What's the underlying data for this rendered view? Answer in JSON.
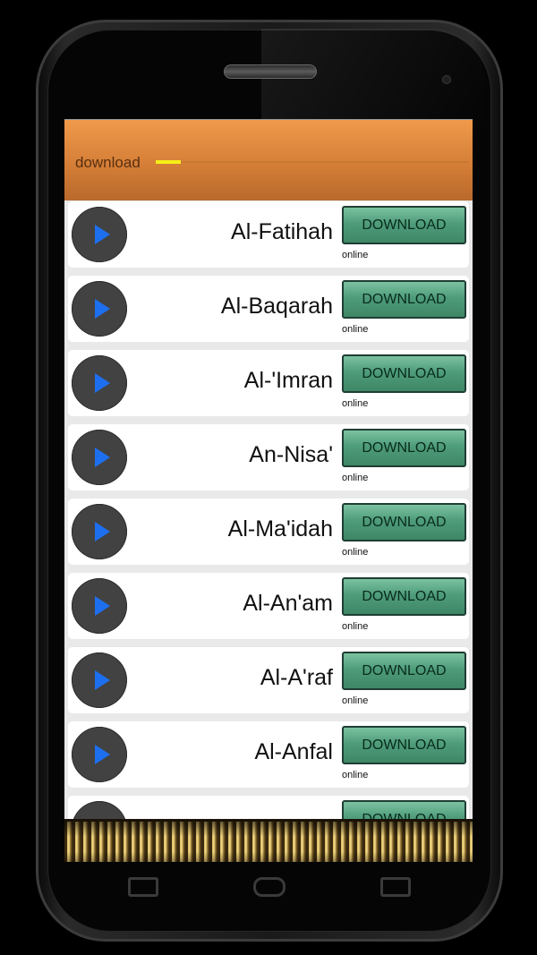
{
  "appbar": {
    "title": "download",
    "progress": 0.08,
    "progress_color": "#f5ef19"
  },
  "icons": {
    "play": "play-icon"
  },
  "colors": {
    "header_orange": "#e38a40",
    "download_green": "#4e9c7a",
    "play_blue": "#1e6ff0"
  },
  "list": {
    "items": [
      {
        "name": "Al-Fatihah",
        "button": "DOWNLOAD",
        "status": "online"
      },
      {
        "name": "Al-Baqarah",
        "button": "DOWNLOAD",
        "status": "online"
      },
      {
        "name": "Al-'Imran",
        "button": "DOWNLOAD",
        "status": "online"
      },
      {
        "name": "An-Nisa'",
        "button": "DOWNLOAD",
        "status": "online"
      },
      {
        "name": "Al-Ma'idah",
        "button": "DOWNLOAD",
        "status": "online"
      },
      {
        "name": "Al-An'am",
        "button": "DOWNLOAD",
        "status": "online"
      },
      {
        "name": "Al-A'raf",
        "button": "DOWNLOAD",
        "status": "online"
      },
      {
        "name": "Al-Anfal",
        "button": "DOWNLOAD",
        "status": "online"
      },
      {
        "name": "",
        "button": "DOWNLOAD",
        "status": ""
      }
    ]
  }
}
